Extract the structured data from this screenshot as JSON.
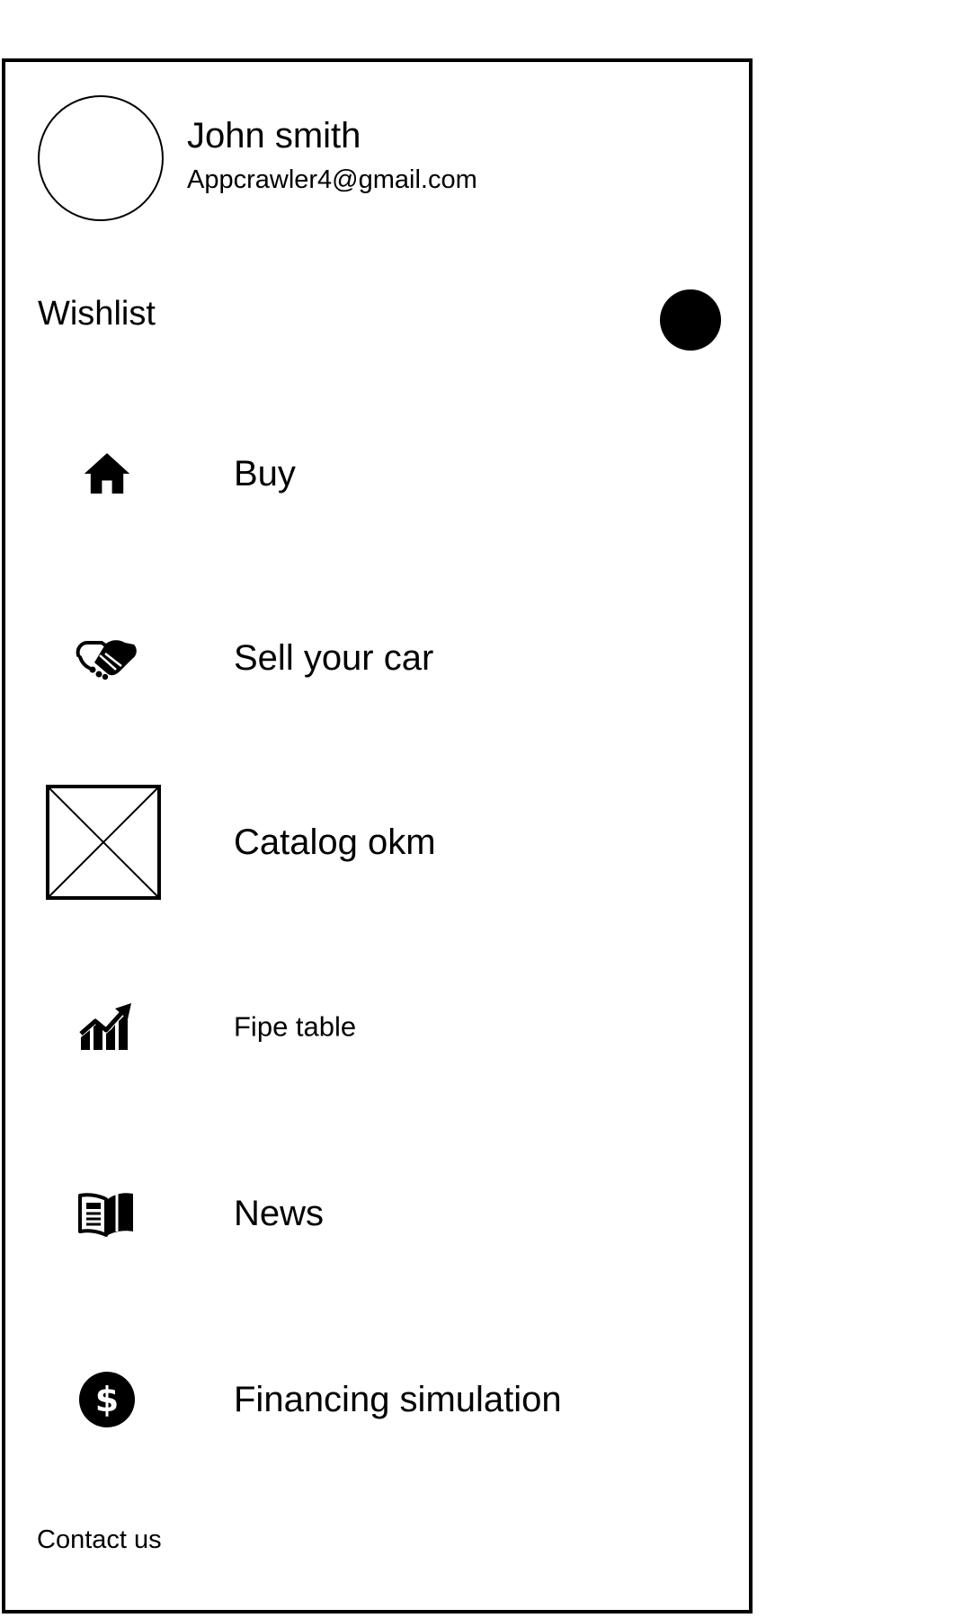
{
  "profile": {
    "name": "John smith",
    "email": "Appcrawler4@gmail.com"
  },
  "wishlist": {
    "label": "Wishlist"
  },
  "menu": {
    "items": [
      {
        "label": "Buy",
        "icon": "home-icon"
      },
      {
        "label": "Sell your car",
        "icon": "handshake-icon"
      },
      {
        "label": "Catalog okm",
        "icon": "image-placeholder-icon"
      },
      {
        "label": "Fipe table",
        "icon": "chart-trend-icon"
      },
      {
        "label": "News",
        "icon": "news-book-icon"
      },
      {
        "label": "Financing simulation",
        "icon": "dollar-coin-icon"
      }
    ]
  },
  "footer": {
    "contact_label": "Contact us"
  }
}
